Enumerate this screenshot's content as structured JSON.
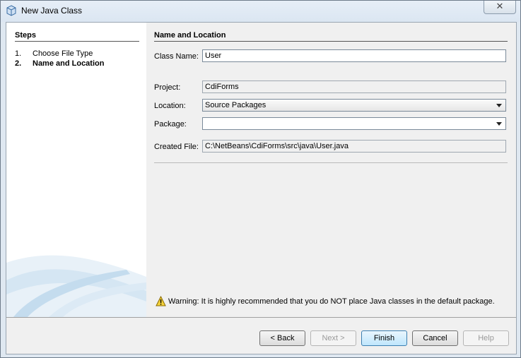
{
  "window": {
    "title": "New Java Class",
    "close_glyph": "✕"
  },
  "steps": {
    "title": "Steps",
    "items": [
      {
        "num": "1.",
        "label": "Choose File Type"
      },
      {
        "num": "2.",
        "label": "Name and Location"
      }
    ]
  },
  "section": {
    "title": "Name and Location"
  },
  "form": {
    "class_name": {
      "label": "Class Name:",
      "value": "User"
    },
    "project": {
      "label": "Project:",
      "value": "CdiForms"
    },
    "location": {
      "label": "Location:",
      "value": "Source Packages"
    },
    "package": {
      "label": "Package:",
      "value": ""
    },
    "created_file": {
      "label": "Created File:",
      "value": "C:\\NetBeans\\CdiForms\\src\\java\\User.java"
    }
  },
  "warning": {
    "icon": "warning-icon",
    "text": "Warning: It is highly recommended that you do NOT place Java classes in the default package."
  },
  "buttons": {
    "back": "< Back",
    "next": "Next >",
    "finish": "Finish",
    "cancel": "Cancel",
    "help": "Help"
  }
}
